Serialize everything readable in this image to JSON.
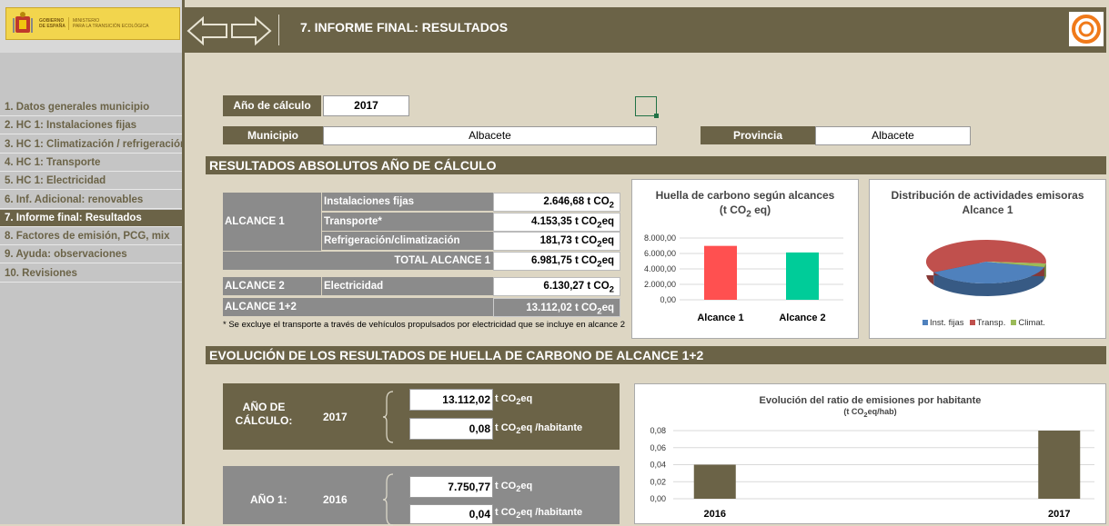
{
  "logo": {
    "line1a": "GOBIERNO",
    "line1b": "DE ESPAÑA",
    "line2a": "MINISTERIO",
    "line2b": "PARA LA TRANSICIÓN ECOLÓGICA"
  },
  "nav": [
    {
      "label": "1. Datos generales municipio",
      "active": false
    },
    {
      "label": "2. HC 1: Instalaciones fijas",
      "active": false
    },
    {
      "label": "3. HC 1: Climatización / refrigeración",
      "active": false
    },
    {
      "label": "4. HC 1: Transporte",
      "active": false
    },
    {
      "label": "5. HC 1: Electricidad",
      "active": false
    },
    {
      "label": "6.  Inf. Adicional: renovables",
      "active": false
    },
    {
      "label": "7. Informe final: Resultados",
      "active": true
    },
    {
      "label": "8. Factores de emisión, PCG, mix",
      "active": false
    },
    {
      "label": "9. Ayuda: observaciones",
      "active": false
    },
    {
      "label": "10. Revisiones",
      "active": false
    }
  ],
  "header": {
    "title": "7. INFORME FINAL: RESULTADOS"
  },
  "form": {
    "year_label": "Año de cálculo",
    "year_value": "2017",
    "municipio_label": "Municipio",
    "municipio_value": "Albacete",
    "provincia_label": "Provincia",
    "provincia_value": "Albacete"
  },
  "section1": "RESULTADOS ABSOLUTOS AÑO DE CÁLCULO",
  "results": {
    "alcance1": "ALCANCE 1",
    "rows": [
      {
        "label": "Instalaciones fijas",
        "value": "2.646,68",
        "unit": "t CO",
        "sub": "2",
        "suffix": ""
      },
      {
        "label": "Transporte*",
        "value": "4.153,35",
        "unit": "t CO",
        "sub": "2",
        "suffix": "eq"
      },
      {
        "label": "Refrigeración/climatización",
        "value": "181,73",
        "unit": "t CO",
        "sub": "2",
        "suffix": "eq"
      }
    ],
    "total_label": "TOTAL ALCANCE 1",
    "total_value": "6.981,75",
    "total_unit": "t CO",
    "total_sub": "2",
    "total_suffix": "eq",
    "alcance2": "ALCANCE 2",
    "elec_label": "Electricidad",
    "elec_value": "6.130,27",
    "elec_unit": "t CO",
    "elec_sub": "2",
    "alcance12": "ALCANCE 1+2",
    "a12_value": "13.112,02",
    "a12_unit": "t CO",
    "a12_sub": "2",
    "a12_suffix": "eq",
    "note": "* Se excluye el transporte a través de vehículos propulsados por electricidad que se incluye en alcance 2"
  },
  "chart1": {
    "title1": "Huella de carbono según alcances",
    "title2a": "(t CO",
    "title2sub": "2",
    "title2b": " eq)",
    "yticks": [
      "8.000,00",
      "6.000,00",
      "4.000,00",
      "2.000,00",
      "0,00"
    ]
  },
  "chart2": {
    "title1": "Distribución de actividades emisoras",
    "title2": "Alcance 1",
    "legend": [
      {
        "label": "Inst. fijas",
        "color": "#4f81bd"
      },
      {
        "label": "Transp.",
        "color": "#c0504d"
      },
      {
        "label": "Climat.",
        "color": "#9bbb59"
      }
    ]
  },
  "section2": "EVOLUCIÓN DE LOS RESULTADOS DE HUELLA DE CARBONO DE ALCANCE 1+2",
  "evo": {
    "year_label1": "AÑO DE",
    "year_label2": "CÁLCULO:",
    "year": "2017",
    "v1": "13.112,02",
    "u1a": "t CO",
    "u1sub": "2",
    "u1b": "eq",
    "v2": "0,08",
    "u2a": "t CO",
    "u2sub": "2",
    "u2b": "eq /habitante",
    "y1_label": "AÑO 1:",
    "y1_year": "2016",
    "v3": "7.750,77",
    "u3a": "t CO",
    "u3sub": "2",
    "u3b": "eq",
    "v4": "0,04",
    "u4a": "t CO",
    "u4sub": "2",
    "u4b": "eq /habitante"
  },
  "chart3": {
    "title1": "Evolución del ratio de emisiones por habitante",
    "title2": "(t CO",
    "title2sub": "2",
    "title2b": "eq/hab)",
    "yticks": [
      "0,08",
      "0,06",
      "0,04",
      "0,02",
      "0,00"
    ]
  },
  "chart_data": [
    {
      "type": "bar",
      "title": "Huella de carbono según alcances (t CO2 eq)",
      "categories": [
        "Alcance 1",
        "Alcance 2"
      ],
      "values": [
        6981.75,
        6130.27
      ],
      "colors": [
        "#ff5050",
        "#00cc99"
      ],
      "ylim": [
        0,
        8000
      ],
      "grid": true
    },
    {
      "type": "pie",
      "title": "Distribución de actividades emisoras Alcance 1",
      "categories": [
        "Inst. fijas",
        "Transp.",
        "Climat."
      ],
      "values": [
        2646.68,
        4153.35,
        181.73
      ],
      "colors": [
        "#4f81bd",
        "#c0504d",
        "#9bbb59"
      ],
      "legend": "bottom"
    },
    {
      "type": "bar",
      "title": "Evolución del ratio de emisiones por habitante (t CO2eq/hab)",
      "categories": [
        "2016",
        "2017"
      ],
      "values": [
        0.04,
        0.08
      ],
      "colors": [
        "#6b6347",
        "#6b6347"
      ],
      "ylim": [
        0,
        0.08
      ],
      "grid": true
    }
  ]
}
